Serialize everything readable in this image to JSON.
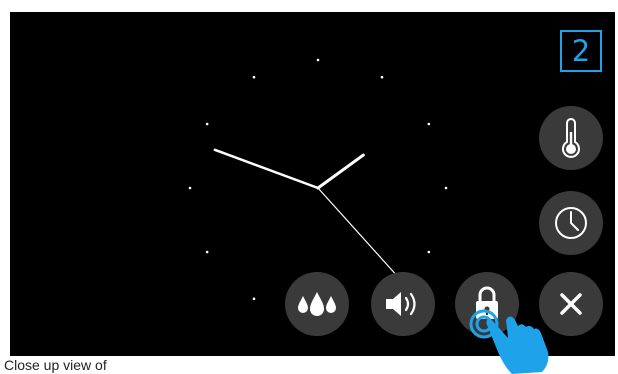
{
  "screen": {
    "page_indicator": "2",
    "accent_color": "#1ea3ea",
    "button_color": "#3a3a3a",
    "side_buttons": [
      {
        "id": "temperature",
        "icon": "thermometer-icon"
      },
      {
        "id": "clock",
        "icon": "clock-icon"
      }
    ],
    "bottom_buttons": [
      {
        "id": "water",
        "icon": "water-drops-icon"
      },
      {
        "id": "volume",
        "icon": "speaker-icon"
      },
      {
        "id": "lock",
        "icon": "padlock-icon",
        "state": "being tapped"
      },
      {
        "id": "close",
        "icon": "close-x-icon"
      }
    ],
    "analog_clock": {
      "hour": 1,
      "minute": 48,
      "second": 23
    }
  },
  "caption": "Close up view of"
}
